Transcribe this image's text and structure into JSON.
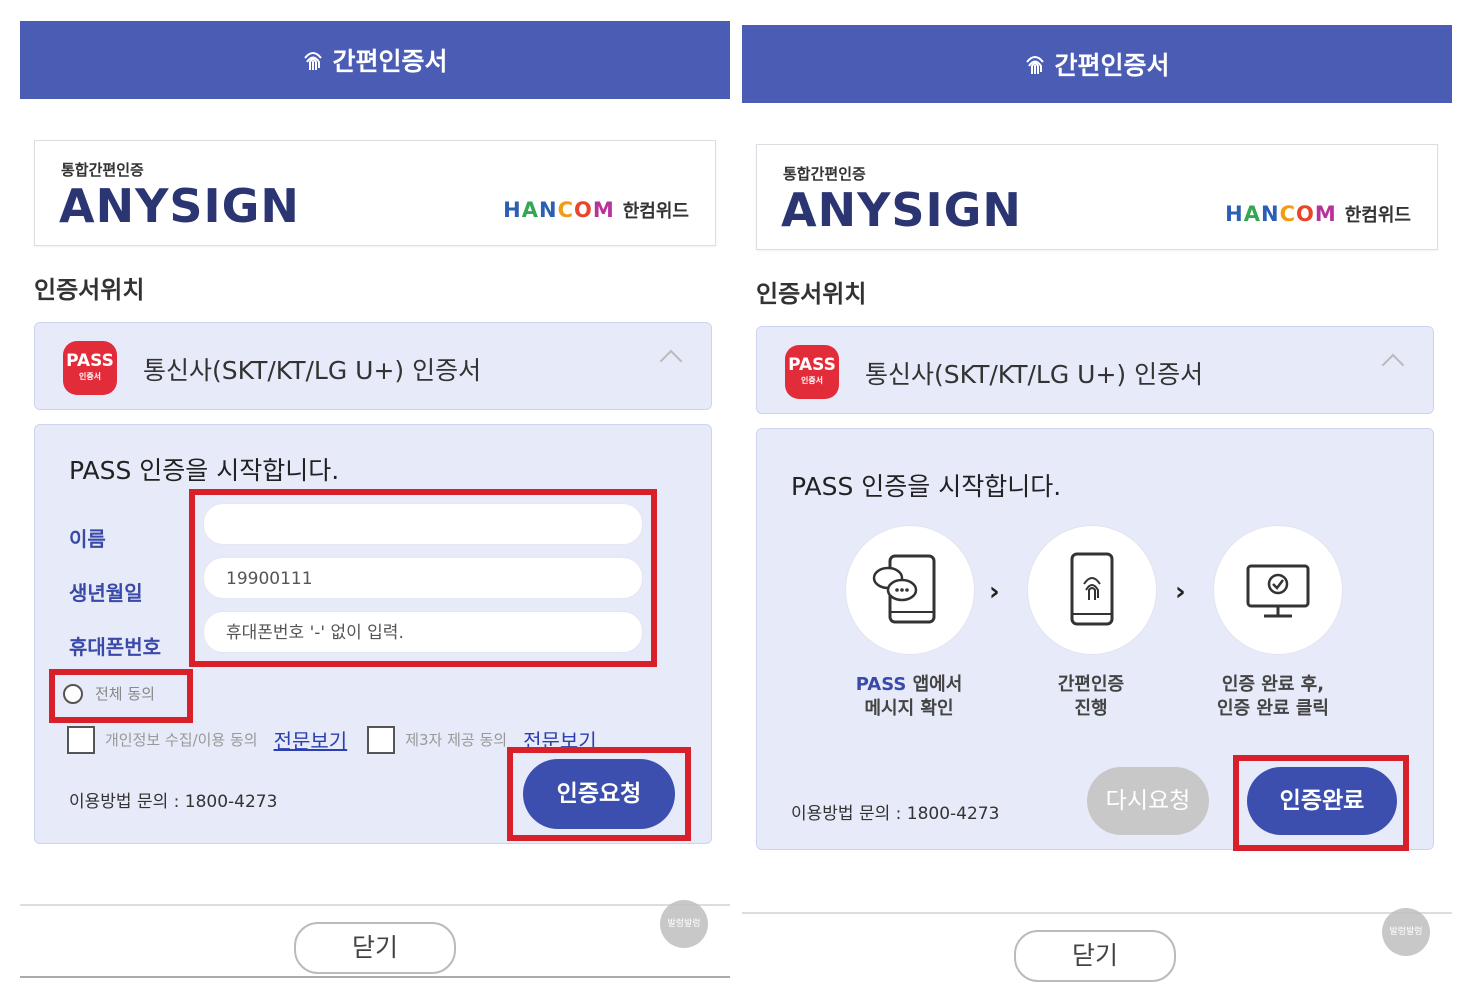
{
  "header": {
    "title": "간편인증서"
  },
  "brand": {
    "small": "통합간편인증",
    "big": "ANYSIGN",
    "hancom": [
      "H",
      "A",
      "N",
      "C",
      "O",
      "M"
    ],
    "hancom_kr": "한컴위드"
  },
  "location_label": "인증서위치",
  "carrier": {
    "badge_main": "PASS",
    "badge_sub": "인증서",
    "label": "통신사(SKT/KT/LG U+) 인증서"
  },
  "left": {
    "start_text": "PASS 인증을 시작합니다.",
    "fields": [
      {
        "label": "이름",
        "value": ""
      },
      {
        "label": "생년월일",
        "value": "19900111"
      },
      {
        "label": "휴대폰번호",
        "placeholder": "휴대폰번호 '-' 없이 입력."
      }
    ],
    "agree_all": "전체 동의",
    "agree_privacy": "개인정보 수집/이용 동의",
    "agree_third": "제3자 제공 동의",
    "view_full": "전문보기",
    "help": "이용방법 문의 : 1800-4273",
    "request_button": "인증요청"
  },
  "right": {
    "start_text": "PASS 인증을 시작합니다.",
    "steps": [
      {
        "line1_blue": "PASS",
        "line1_rest": " 앱에서",
        "line2": "메시지 확인",
        "icon": "phone-message-icon"
      },
      {
        "line1_blue": "",
        "line1_rest": "간편인증",
        "line2": "진행",
        "icon": "phone-fingerprint-icon"
      },
      {
        "line1_blue": "",
        "line1_rest": "인증 완료 후,",
        "line2": "인증 완료 클릭",
        "icon": "monitor-check-icon"
      }
    ],
    "help": "이용방법 문의 : 1800-4273",
    "retry_button": "다시요청",
    "done_button": "인증완료"
  },
  "footer": {
    "close_button": "닫기",
    "badge_text": "발렁발렁"
  },
  "colors": {
    "header": "#4a5cb4",
    "highlight": "#d8202b",
    "pass_red": "#e32c3a",
    "button_blue": "#3c4fae"
  }
}
